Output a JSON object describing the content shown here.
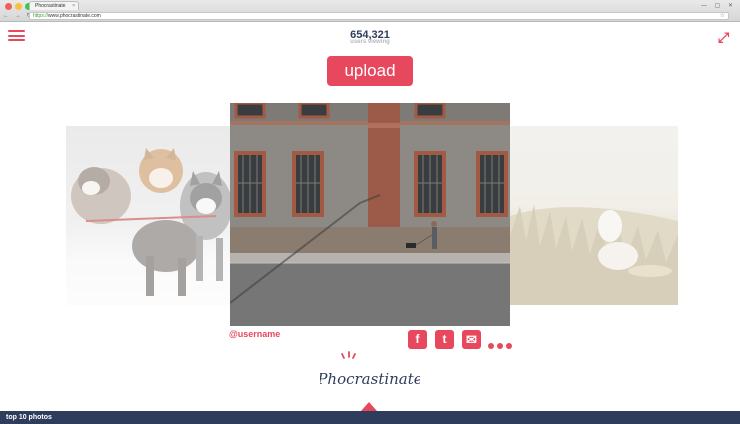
{
  "browser": {
    "tab_title": "Phocrastinate",
    "tab_close": "×",
    "url_secure": "https://",
    "url_rest": "www.phocrastinate.com",
    "nav_glyphs": "← → ↻",
    "window_controls": "— ▢ ✕",
    "star": "☆",
    "traffic_colors": [
      "#f25f58",
      "#fbbe3e",
      "#39c94a"
    ]
  },
  "header": {
    "viewer_count": "654,321",
    "viewer_label": "users viewing",
    "upload_label": "upload",
    "expand_glyph": "⤢"
  },
  "photo": {
    "username": "@username"
  },
  "share": {
    "facebook": "f",
    "twitter": "t",
    "email": "✉"
  },
  "logo": {
    "text": "Phocrastinate"
  },
  "footer": {
    "label": "top 10 photos"
  },
  "colors": {
    "accent": "#e8485d",
    "navy": "#2f3d5c",
    "muted": "#b8b8b8"
  }
}
